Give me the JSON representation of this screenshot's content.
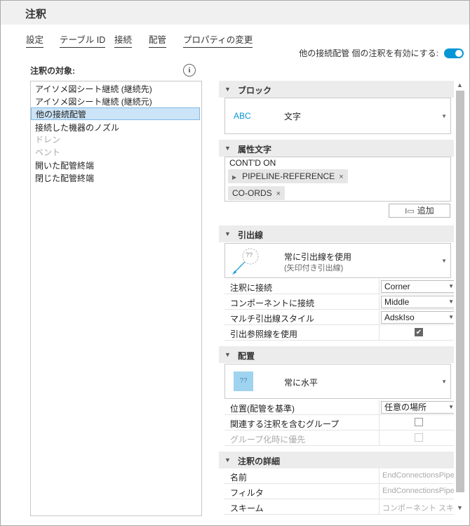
{
  "window": {
    "title": "注釈"
  },
  "tabs": [
    {
      "label": "設定"
    },
    {
      "label": "テーブル ID"
    },
    {
      "label": "接続"
    },
    {
      "label": "配管"
    },
    {
      "label": "プロパティの変更"
    }
  ],
  "toggle": {
    "label": "他の接続配管 個の注釈を有効にする:",
    "on": true
  },
  "left": {
    "header": "注釈の対象:",
    "items": [
      {
        "label": "アイソメ図シート継続 (継続先)",
        "state": "normal"
      },
      {
        "label": "アイソメ図シート継続 (継続元)",
        "state": "normal"
      },
      {
        "label": "他の接続配管",
        "state": "selected"
      },
      {
        "label": "接続した機器のノズル",
        "state": "normal"
      },
      {
        "label": "ドレン",
        "state": "disabled"
      },
      {
        "label": "ベント",
        "state": "disabled"
      },
      {
        "label": "開いた配管終端",
        "state": "normal"
      },
      {
        "label": "閉じた配管終端",
        "state": "normal"
      }
    ]
  },
  "block": {
    "title": "ブロック",
    "preview": "ABC",
    "value": "文字"
  },
  "attr": {
    "title": "属性文字",
    "first_line": "CONT'D ON",
    "chips": [
      "PIPELINE-REFERENCE",
      "CO-ORDS"
    ],
    "add_label": "追加"
  },
  "leader": {
    "title": "引出線",
    "preview": "??",
    "value_line1": "常に引出線を使用",
    "value_line2": "(矢印付き引出線)",
    "props": [
      {
        "label": "注釈に接続",
        "value": "Corner"
      },
      {
        "label": "コンポーネントに接続",
        "value": "Middle"
      },
      {
        "label": "マルチ引出線スタイル",
        "value": "AdskIso"
      }
    ],
    "check_label": "引出参照線を使用",
    "check_on": true
  },
  "placement": {
    "title": "配置",
    "preview": "??",
    "value": "常に水平",
    "prop_label": "位置(配管を基準)",
    "prop_value": "任意の場所",
    "group_label": "関連する注釈を含むグループ",
    "priority_label": "グループ化時に優先"
  },
  "details": {
    "title": "注釈の詳細",
    "rows": [
      {
        "label": "名前",
        "value": "EndConnectionsPipe"
      },
      {
        "label": "フィルタ",
        "value": "EndConnectionsPipe"
      },
      {
        "label": "スキーム",
        "value": "コンポーネント スキーム"
      }
    ]
  },
  "colors": {
    "accent": "#0696d7",
    "selection": "#cce4f7"
  }
}
